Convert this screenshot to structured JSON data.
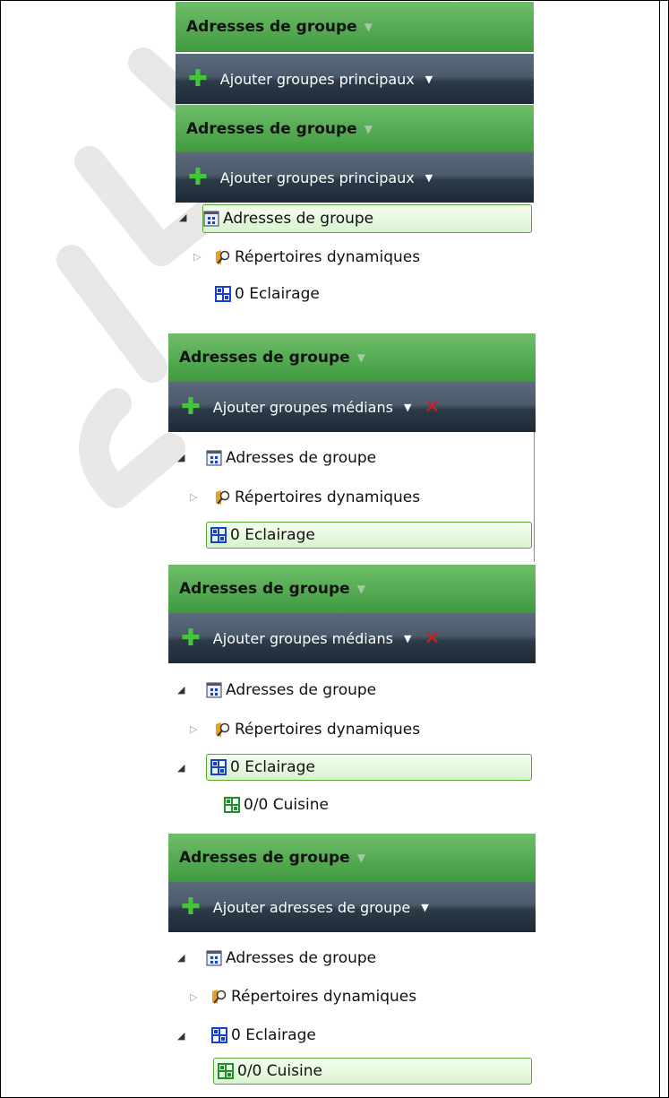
{
  "colors": {
    "header_green": "#4aa24a",
    "toolbar_dark": "#2d3b49",
    "plus_green": "#45c53c",
    "delete_red": "#d21e1e",
    "selection_border": "#58a834",
    "group_icon_blue": "#1a3fd0",
    "group_icon_green": "#1f8f2a"
  },
  "icons": {
    "plus": "plus-icon",
    "dropdown": "chevron-down-icon",
    "delete": "close-icon",
    "root": "group-addresses-icon",
    "dynamic": "dynamic-folder-icon",
    "main_group": "main-group-icon",
    "middle_group": "middle-group-icon"
  },
  "panels": [
    {
      "header": "Adresses de groupe",
      "toolbar": "Ajouter groupes principaux",
      "show_delete": false,
      "tree": []
    },
    {
      "header": "Adresses de groupe",
      "toolbar": "Ajouter groupes principaux",
      "show_delete": false,
      "tree": [
        "Adresses de groupe",
        "Répertoires dynamiques",
        "0 Eclairage"
      ]
    },
    {
      "header": "Adresses de groupe",
      "toolbar": "Ajouter groupes médians",
      "show_delete": true,
      "tree": [
        "Adresses de groupe",
        "Répertoires dynamiques",
        "0 Eclairage"
      ]
    },
    {
      "header": "Adresses de groupe",
      "toolbar": "Ajouter groupes médians",
      "show_delete": true,
      "tree": [
        "Adresses de groupe",
        "Répertoires dynamiques",
        "0 Eclairage",
        "0/0 Cuisine"
      ]
    },
    {
      "header": "Adresses de groupe",
      "toolbar": "Ajouter adresses de groupe",
      "show_delete": false,
      "tree": [
        "Adresses de groupe",
        "Répertoires dynamiques",
        "0 Eclairage",
        "0/0 Cuisine"
      ]
    }
  ],
  "tree_state": {
    "selected": [
      null,
      0,
      2,
      2,
      3
    ],
    "expanders": {
      "root": "expanded",
      "dynamic": "collapsed",
      "main_group_panel4": "expanded",
      "main_group_panel5": "expanded"
    }
  }
}
